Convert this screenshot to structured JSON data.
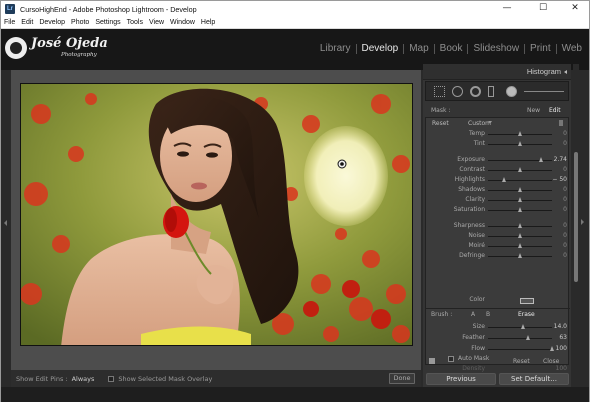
{
  "window": {
    "title": "CursoHighEnd - Adobe Photoshop Lightroom - Develop",
    "icon_text": "Lr",
    "controls": [
      "minimize-icon",
      "maximize-icon",
      "close-icon"
    ]
  },
  "menu": [
    "File",
    "Edit",
    "Develop",
    "Photo",
    "Settings",
    "Tools",
    "View",
    "Window",
    "Help"
  ],
  "logo": {
    "name": "José Ojeda",
    "sub": "Photography"
  },
  "modules": [
    {
      "label": "Library",
      "active": false
    },
    {
      "label": "Develop",
      "active": true
    },
    {
      "label": "Map",
      "active": false
    },
    {
      "label": "Book",
      "active": false
    },
    {
      "label": "Slideshow",
      "active": false
    },
    {
      "label": "Print",
      "active": false
    },
    {
      "label": "Web",
      "active": false
    }
  ],
  "toolbar": {
    "show_pins_label": "Show Edit Pins :",
    "show_pins_value": "Always",
    "overlay_label": "Show Selected Mask Overlay",
    "done_label": "Done"
  },
  "panel": {
    "histogram_label": "Histogram",
    "mask_label": "Mask :",
    "new_label": "New",
    "edit_label": "Edit",
    "reset_label": "Reset",
    "custom_label": "Custom",
    "color_label": "Color",
    "sliders": [
      {
        "label": "Temp",
        "value": "0",
        "pos": 0.5
      },
      {
        "label": "Tint",
        "value": "0",
        "pos": 0.5
      },
      {
        "label": "Exposure",
        "value": "2.74",
        "pos": 0.84
      },
      {
        "label": "Contrast",
        "value": "0",
        "pos": 0.5
      },
      {
        "label": "Highlights",
        "value": "− 50",
        "pos": 0.25
      },
      {
        "label": "Shadows",
        "value": "0",
        "pos": 0.5
      },
      {
        "label": "Clarity",
        "value": "0",
        "pos": 0.5
      },
      {
        "label": "Saturation",
        "value": "0",
        "pos": 0.5
      },
      {
        "label": "Sharpness",
        "value": "0",
        "pos": 0.5
      },
      {
        "label": "Noise",
        "value": "0",
        "pos": 0.5
      },
      {
        "label": "Moiré",
        "value": "0",
        "pos": 0.5
      },
      {
        "label": "Defringe",
        "value": "0",
        "pos": 0.5
      }
    ],
    "brush": {
      "label": "Brush :",
      "a": "A",
      "b": "B",
      "erase": "Erase",
      "size_label": "Size",
      "size_value": "14.0",
      "feather_label": "Feather",
      "feather_value": "63",
      "flow_label": "Flow",
      "flow_value": "100",
      "auto_mask_label": "Auto Mask",
      "density_label": "Density",
      "density_value": "100"
    },
    "bottom_reset": "Reset",
    "bottom_close": "Close"
  },
  "buttons": {
    "previous": "Previous",
    "set_default": "Set Default..."
  },
  "colors": {
    "header_bg": "#171717",
    "panel_bg": "#3b3b3b",
    "active_module": "#e8e8e8",
    "inactive_module": "#8e8e8e"
  }
}
